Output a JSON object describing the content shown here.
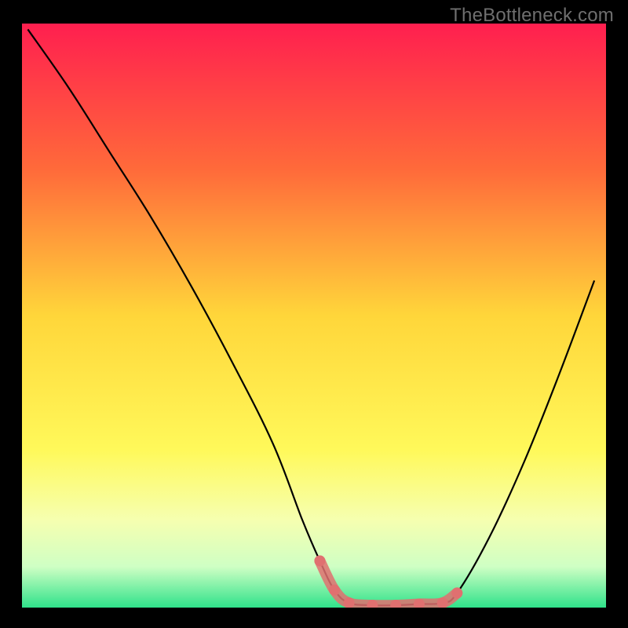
{
  "watermark": "TheBottleneck.com",
  "chart_data": {
    "type": "line",
    "title": "",
    "xlabel": "",
    "ylabel": "",
    "xlim": [
      0,
      100
    ],
    "ylim": [
      0,
      100
    ],
    "gradient_stops": [
      {
        "offset": 0,
        "color": "#ff1f4f"
      },
      {
        "offset": 25,
        "color": "#ff6a3a"
      },
      {
        "offset": 50,
        "color": "#ffd63a"
      },
      {
        "offset": 73,
        "color": "#fff95a"
      },
      {
        "offset": 85,
        "color": "#f6ffb0"
      },
      {
        "offset": 93,
        "color": "#cfffc4"
      },
      {
        "offset": 100,
        "color": "#2fe28a"
      }
    ],
    "series": [
      {
        "name": "curve",
        "color": "#000000",
        "width": 2.2,
        "x": [
          1,
          8,
          15,
          22,
          29,
          36,
          43,
          48,
          51,
          53.5,
          56,
          60,
          64,
          68,
          72,
          74.5,
          80,
          86,
          92,
          98
        ],
        "y": [
          99,
          89,
          78,
          67,
          55,
          42,
          28,
          15,
          8,
          3,
          0.8,
          0.4,
          0.4,
          0.6,
          0.8,
          2.5,
          12,
          25,
          40,
          56
        ]
      },
      {
        "name": "highlight-dots",
        "color": "#e07070",
        "radius": 7,
        "x": [
          51,
          53.5,
          56,
          60,
          64,
          68,
          72,
          74.5
        ],
        "y": [
          8,
          3,
          0.8,
          0.4,
          0.4,
          0.6,
          0.8,
          2.5
        ]
      }
    ]
  }
}
